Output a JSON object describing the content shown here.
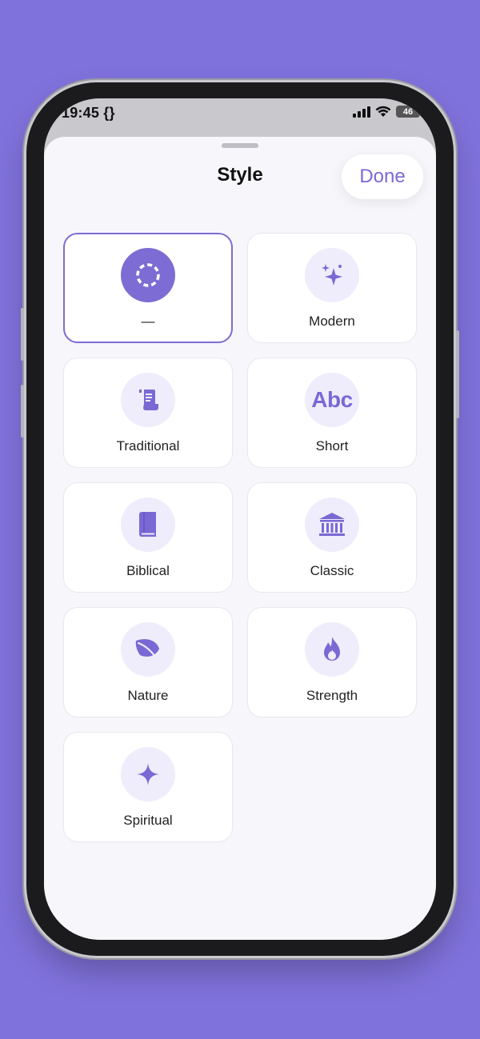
{
  "status": {
    "time": "19:45 {}",
    "battery": "46"
  },
  "sheet": {
    "title": "Style",
    "done_label": "Done"
  },
  "styles": [
    {
      "label": "—",
      "icon": "dashed-circle-icon",
      "selected": true
    },
    {
      "label": "Modern",
      "icon": "sparkles-icon"
    },
    {
      "label": "Traditional",
      "icon": "scroll-icon"
    },
    {
      "label": "Short",
      "icon": "abc-text-icon",
      "icon_text": "Abc"
    },
    {
      "label": "Biblical",
      "icon": "book-icon"
    },
    {
      "label": "Classic",
      "icon": "building-columns-icon"
    },
    {
      "label": "Nature",
      "icon": "leaf-icon"
    },
    {
      "label": "Strength",
      "icon": "flame-icon"
    },
    {
      "label": "Spiritual",
      "icon": "sparkle-icon"
    }
  ],
  "colors": {
    "background": "#8072dc",
    "accent": "#7d6cd4",
    "icon_bg": "#efedfb"
  }
}
